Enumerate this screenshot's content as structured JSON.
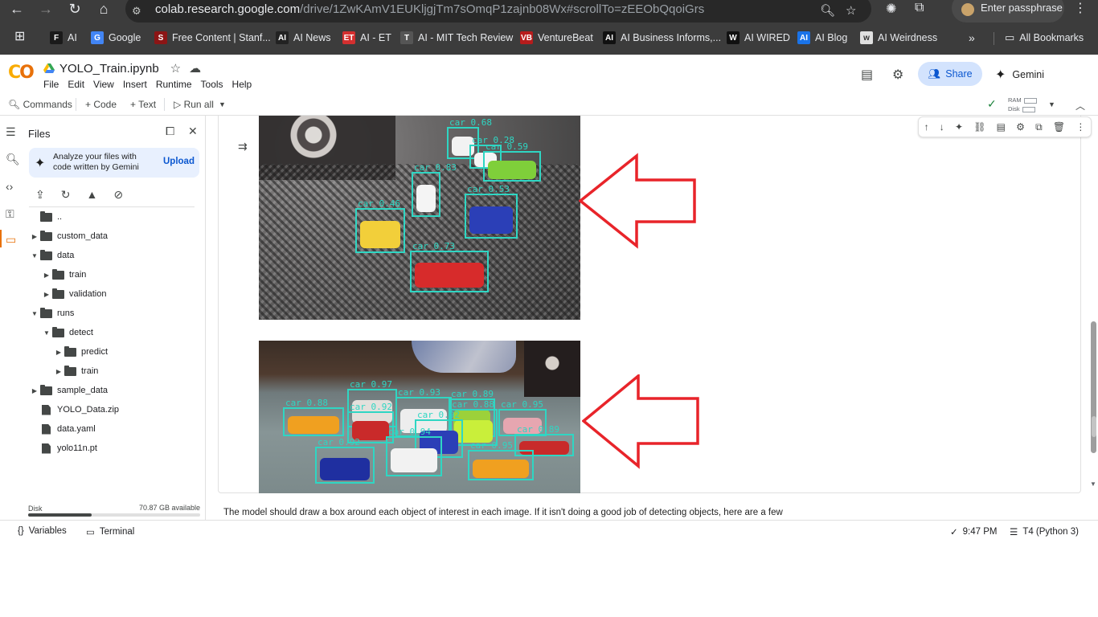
{
  "browser": {
    "url_main": "colab.research.google.com",
    "url_rest": "/drive/1ZwKAmV1EUKljgjTm7sOmqP1zajnb08Wx#scrollTo=zEEObQqoiGrs",
    "passphrase_label": "Enter passphrase",
    "bookmarks": [
      {
        "label": "AI",
        "fav": "F",
        "color": "#1a1a1a"
      },
      {
        "label": "Google",
        "fav": "G",
        "color": "#4285f4"
      },
      {
        "label": "Free Content | Stanf...",
        "fav": "S",
        "color": "#8c1515"
      },
      {
        "label": "AI News",
        "fav": "AI",
        "color": "#222222"
      },
      {
        "label": "AI - ET",
        "fav": "ET",
        "color": "#d32f2f"
      },
      {
        "label": "AI - MIT Tech Review",
        "fav": "T",
        "color": "#555555"
      },
      {
        "label": "VentureBeat",
        "fav": "VB",
        "color": "#b71c1c"
      },
      {
        "label": "AI Business Informs,...",
        "fav": "AI",
        "color": "#111111"
      },
      {
        "label": "AI WIRED",
        "fav": "W",
        "color": "#111111"
      },
      {
        "label": "AI Blog",
        "fav": "AI",
        "color": "#1a73e8"
      },
      {
        "label": "AI Weirdness",
        "fav": "w",
        "color": "#e0e0e0"
      }
    ],
    "all_bookmarks": "All Bookmarks"
  },
  "colab": {
    "notebook_title": "YOLO_Train.ipynb",
    "menus": [
      "File",
      "Edit",
      "View",
      "Insert",
      "Runtime",
      "Tools",
      "Help"
    ],
    "share_label": "Share",
    "gemini_label": "Gemini",
    "commands_label": "Commands",
    "code_label": "+ Code",
    "text_label": "+ Text",
    "run_all_label": "Run all",
    "ram_label": "RAM",
    "disk_label": "Disk"
  },
  "files_panel": {
    "title": "Files",
    "gemini_card_text": "Analyze your files with code written by Gemini",
    "upload_label": "Upload",
    "tree": [
      {
        "name": "..",
        "type": "folder",
        "depth": 0,
        "caret": ""
      },
      {
        "name": "custom_data",
        "type": "folder",
        "depth": 0,
        "caret": "▶"
      },
      {
        "name": "data",
        "type": "folder",
        "depth": 0,
        "caret": "▼"
      },
      {
        "name": "train",
        "type": "folder",
        "depth": 1,
        "caret": "▶"
      },
      {
        "name": "validation",
        "type": "folder",
        "depth": 1,
        "caret": "▶"
      },
      {
        "name": "runs",
        "type": "folder",
        "depth": 0,
        "caret": "▼"
      },
      {
        "name": "detect",
        "type": "folder",
        "depth": 1,
        "caret": "▼"
      },
      {
        "name": "predict",
        "type": "folder",
        "depth": 2,
        "caret": "▶"
      },
      {
        "name": "train",
        "type": "folder",
        "depth": 2,
        "caret": "▶"
      },
      {
        "name": "sample_data",
        "type": "folder",
        "depth": 0,
        "caret": "▶"
      },
      {
        "name": "YOLO_Data.zip",
        "type": "file",
        "depth": 0,
        "caret": ""
      },
      {
        "name": "data.yaml",
        "type": "file",
        "depth": 0,
        "caret": ""
      },
      {
        "name": "yolo11n.pt",
        "type": "file",
        "depth": 0,
        "caret": ""
      }
    ],
    "disk_label": "Disk",
    "disk_available": "70.87 GB available",
    "disk_used_fraction": 0.37
  },
  "output": {
    "image1_detections": [
      {
        "label": "car 0.68",
        "car_color": "#f2f2f2"
      },
      {
        "label": "car 0.28",
        "car_color": "#f5f5f5"
      },
      {
        "label": "car 0.59",
        "car_color": "#7fcf3a"
      },
      {
        "label": "car 0.83",
        "car_color": "#f4f4f4"
      },
      {
        "label": "car 0.46",
        "car_color": "#f2cf3a"
      },
      {
        "label": "car 0.53",
        "car_color": "#2b3fb7"
      },
      {
        "label": "car 0.73",
        "car_color": "#d72b2b"
      }
    ],
    "image2_detections": [
      {
        "label": "car 0.97",
        "car_color": "#e4e0dc"
      },
      {
        "label": "car 0.93",
        "car_color": "#ededed"
      },
      {
        "label": "car 0.89",
        "car_color": "#9cd13a"
      },
      {
        "label": "car 0.88",
        "car_color": "#f0a020"
      },
      {
        "label": "car 0.92",
        "car_color": "#c92a2a"
      },
      {
        "label": "car 0.88",
        "car_color": "#c9ef3a"
      },
      {
        "label": "car 0.95",
        "car_color": "#e6a6b0"
      },
      {
        "label": "car 0.92",
        "car_color": "#2b3fb7"
      },
      {
        "label": "car 0.94",
        "car_color": "#f2f2f2"
      },
      {
        "label": "car 0.89",
        "car_color": "#c82a2a"
      },
      {
        "label": "car 0.92",
        "car_color": "#1f2fa0"
      },
      {
        "label": "car 0.95",
        "car_color": "#f0a020"
      }
    ],
    "arrow_color": "#e8242a",
    "box_color": "#2fd6c3"
  },
  "markdown_text": "The model should draw a box around each object of interest in each image. If it isn't doing a good job of detecting objects, here are a few",
  "statusbar": {
    "variables_label": "Variables",
    "terminal_label": "Terminal",
    "time": "9:47 PM",
    "runtime": "T4 (Python 3)"
  }
}
